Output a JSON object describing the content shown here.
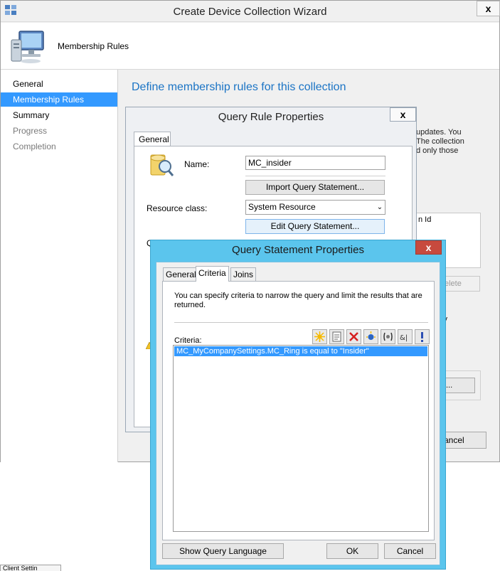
{
  "wizard": {
    "title": "Create Device Collection Wizard",
    "close_glyph": "x",
    "header_title": "Membership Rules",
    "content_title": "Define membership rules for this collection",
    "nav": [
      {
        "label": "General",
        "state": "normal"
      },
      {
        "label": "Membership Rules",
        "state": "active"
      },
      {
        "label": "Summary",
        "state": "normal"
      },
      {
        "label": "Progress",
        "state": "disabled"
      },
      {
        "label": "Completion",
        "state": "disabled"
      }
    ],
    "background": {
      "text_lines": [
        "updates. You",
        "The collection",
        "d only those"
      ],
      "list_column": "n Id",
      "delete_label": "elete",
      "qualify_lines": [
        "at qualify",
        "ction."
      ],
      "dots_label": "...",
      "cancel_label": "ancel"
    }
  },
  "query_rule": {
    "title": "Query Rule Properties",
    "close_glyph": "x",
    "tab_general": "General",
    "name_label": "Name:",
    "name_value": "MC_insider",
    "import_label": "Import Query Statement...",
    "resource_class_label": "Resource class:",
    "resource_class_value": "System Resource",
    "edit_label": "Edit Query Statement...",
    "partial_label": "Q"
  },
  "query_statement": {
    "title": "Query Statement Properties",
    "close_glyph": "x",
    "tabs": [
      "General",
      "Criteria",
      "Joins"
    ],
    "active_tab": "Criteria",
    "description": "You can specify criteria to narrow the query and limit the results that are returned.",
    "criteria_label": "Criteria:",
    "criteria_items": [
      "MC_MyCompanySettings.MC_Ring is equal to \"Insider\""
    ],
    "toolbar_icons": [
      "new-criterion-icon",
      "properties-icon",
      "delete-icon",
      "group-icon",
      "ungroup-icon",
      "and-or-icon",
      "not-icon"
    ],
    "show_query_language_label": "Show Query Language",
    "ok_label": "OK",
    "cancel_label": "Cancel"
  },
  "bottom_tab_label": "Client Settin",
  "colors": {
    "accent": "#3399ff",
    "title_blue": "#1b74c5",
    "active_frame": "#5bc5ed",
    "close_red": "#c74a3e"
  }
}
